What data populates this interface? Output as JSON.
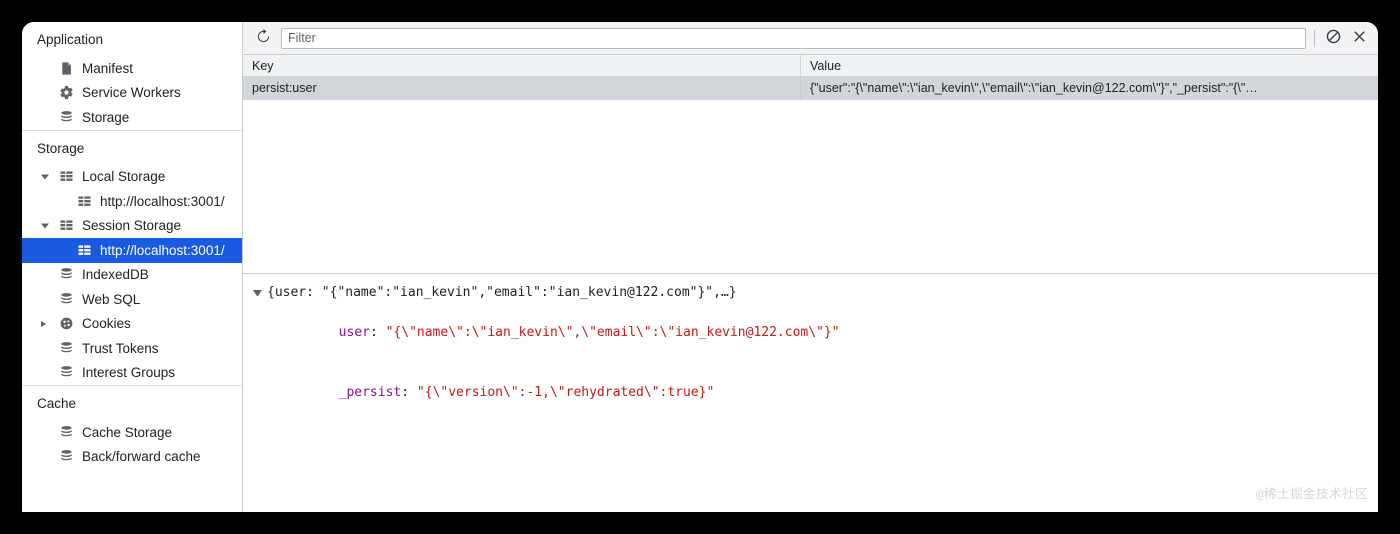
{
  "sidebar": {
    "sections": [
      {
        "title": "Application",
        "items": [
          {
            "label": "Manifest",
            "icon": "manifest-document-icon",
            "indent": 1,
            "twisty": "none",
            "selected": false
          },
          {
            "label": "Service Workers",
            "icon": "gear-icon",
            "indent": 1,
            "twisty": "none",
            "selected": false
          },
          {
            "label": "Storage",
            "icon": "database-icon",
            "indent": 1,
            "twisty": "none",
            "selected": false
          }
        ]
      },
      {
        "title": "Storage",
        "items": [
          {
            "label": "Local Storage",
            "icon": "table-grid-icon",
            "indent": 1,
            "twisty": "open",
            "selected": false
          },
          {
            "label": "http://localhost:3001/",
            "icon": "table-grid-icon",
            "indent": 2,
            "twisty": "none",
            "selected": false
          },
          {
            "label": "Session Storage",
            "icon": "table-grid-icon",
            "indent": 1,
            "twisty": "open",
            "selected": false
          },
          {
            "label": "http://localhost:3001/",
            "icon": "table-grid-icon",
            "indent": 2,
            "twisty": "none",
            "selected": true
          },
          {
            "label": "IndexedDB",
            "icon": "database-icon",
            "indent": 1,
            "twisty": "none",
            "selected": false
          },
          {
            "label": "Web SQL",
            "icon": "database-icon",
            "indent": 1,
            "twisty": "none",
            "selected": false
          },
          {
            "label": "Cookies",
            "icon": "cookie-icon",
            "indent": 1,
            "twisty": "closed",
            "selected": false
          },
          {
            "label": "Trust Tokens",
            "icon": "database-icon",
            "indent": 1,
            "twisty": "none",
            "selected": false
          },
          {
            "label": "Interest Groups",
            "icon": "database-icon",
            "indent": 1,
            "twisty": "none",
            "selected": false
          }
        ]
      },
      {
        "title": "Cache",
        "items": [
          {
            "label": "Cache Storage",
            "icon": "database-icon",
            "indent": 1,
            "twisty": "none",
            "selected": false
          },
          {
            "label": "Back/forward cache",
            "icon": "database-icon",
            "indent": 1,
            "twisty": "none",
            "selected": false
          }
        ]
      }
    ]
  },
  "toolbar": {
    "refresh_icon": "refresh-icon",
    "filter_placeholder": "Filter",
    "filter_value": "",
    "clear_all_icon": "clear-all-circle-slash-icon",
    "delete_selected_icon": "close-x-icon"
  },
  "table": {
    "columns": [
      "Key",
      "Value"
    ],
    "rows": [
      {
        "key": "persist:user",
        "value": "{\"user\":\"{\\\"name\\\":\\\"ian_kevin\\\",\\\"email\\\":\\\"ian_kevin@122.com\\\"}\",\"_persist\":\"{\\\"…",
        "selected": true
      }
    ]
  },
  "preview": {
    "expanded": true,
    "root_line": "{user: \"{\"name\":\"ian_kevin\",\"email\":\"ian_kevin@122.com\"}\",…}",
    "root_parts": [
      {
        "text": "{",
        "type": "plain"
      },
      {
        "text": "user",
        "type": "plain"
      },
      {
        "text": ": ",
        "type": "plain"
      },
      {
        "text": "\"{\"name\":\"ian_kevin\",\"email\":\"ian_kevin@122.com\"}\"",
        "type": "plain"
      },
      {
        "text": ",…}",
        "type": "plain"
      }
    ],
    "children": [
      {
        "key": "user",
        "value": "\"{\\\"name\\\":\\\"ian_kevin\\\",\\\"email\\\":\\\"ian_kevin@122.com\\\"}\""
      },
      {
        "key": "_persist",
        "value": "\"{\\\"version\\\":-1,\\\"rehydrated\\\":true}\""
      }
    ]
  },
  "watermark": {
    "text": "@稀土掘金技术社区"
  },
  "colors": {
    "selection_blue": "#1a5ae0",
    "row_selected_gray": "#d2d6da",
    "toolbar_bg": "#f1f3f4",
    "json_key": "#881391",
    "json_string": "#c41a16"
  }
}
